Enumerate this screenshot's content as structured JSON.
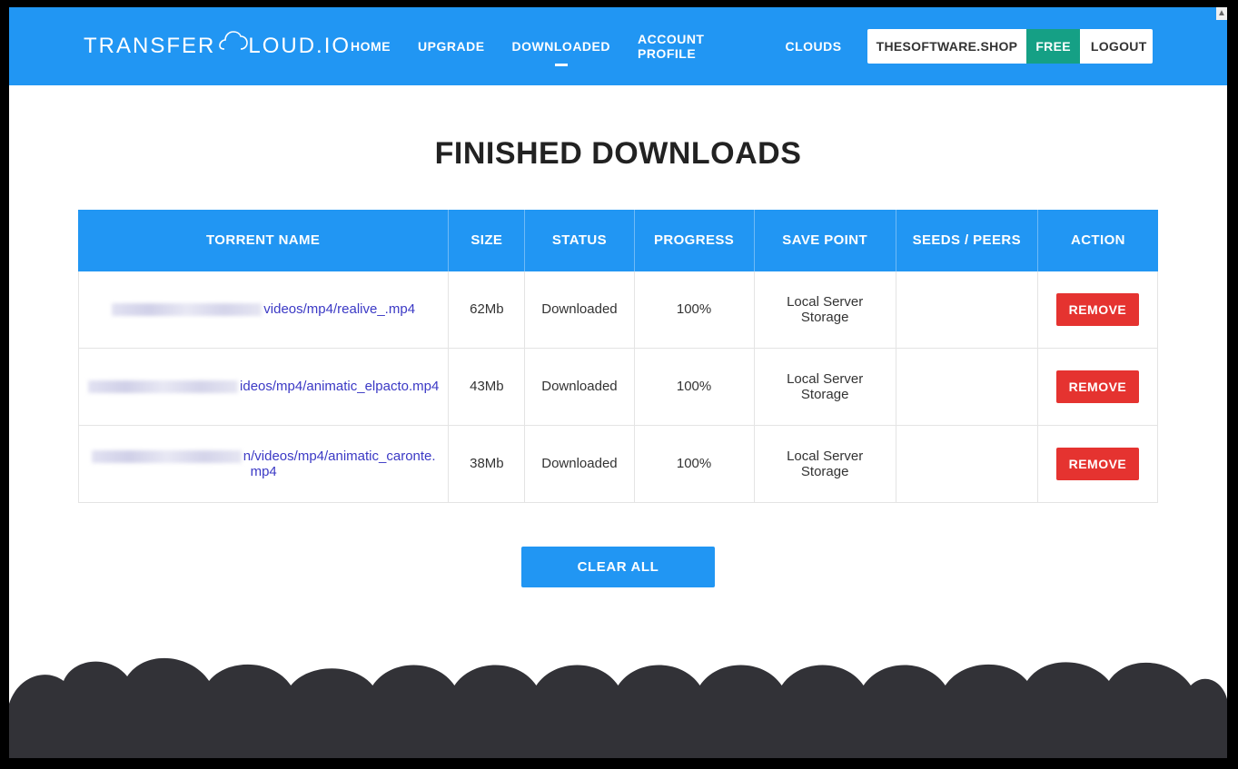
{
  "brand": {
    "name_part1": "TRANSFER",
    "name_part2": "LOUD.IO"
  },
  "nav": {
    "items": [
      {
        "label": "HOME",
        "active": false
      },
      {
        "label": "UPGRADE",
        "active": false
      },
      {
        "label": "DOWNLOADED",
        "active": true
      },
      {
        "label": "ACCOUNT PROFILE",
        "active": false
      },
      {
        "label": "CLOUDS",
        "active": false
      }
    ]
  },
  "account": {
    "name": "THESOFTWARE.SHOP",
    "plan": "FREE",
    "logout": "LOGOUT"
  },
  "page": {
    "title": "FINISHED DOWNLOADS",
    "clear_all": "CLEAR ALL"
  },
  "table": {
    "headers": {
      "name": "TORRENT NAME",
      "size": "SIZE",
      "status": "STATUS",
      "progress": "PROGRESS",
      "savepoint": "SAVE POINT",
      "seeds": "SEEDS / PEERS",
      "action": "ACTION"
    },
    "remove_label": "REMOVE",
    "rows": [
      {
        "name_suffix": "videos/mp4/realive_.mp4",
        "size": "62Mb",
        "status": "Downloaded",
        "progress": "100%",
        "savepoint": "Local Server Storage",
        "seeds": ""
      },
      {
        "name_suffix": "ideos/mp4/animatic_elpacto.mp4",
        "size": "43Mb",
        "status": "Downloaded",
        "progress": "100%",
        "savepoint": "Local Server Storage",
        "seeds": ""
      },
      {
        "name_suffix": "n/videos/mp4/animatic_caronte.mp4",
        "size": "38Mb",
        "status": "Downloaded",
        "progress": "100%",
        "savepoint": "Local Server Storage",
        "seeds": ""
      }
    ]
  }
}
